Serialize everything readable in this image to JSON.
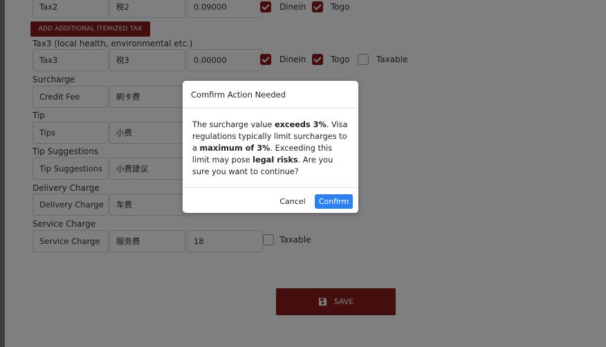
{
  "tax2": {
    "name": "Tax2",
    "name_cn": "税2",
    "rate": "0.09000",
    "dinein_label": "Dinein",
    "togo_label": "Togo"
  },
  "add_tax_button": "ADD ADDITIONAL ITEMIZED TAX",
  "tax3": {
    "section_label": "Tax3 (local health, environmental etc.)",
    "name": "Tax3",
    "name_cn": "税3",
    "rate": "0.00000",
    "dinein_label": "Dinein",
    "togo_label": "Togo",
    "taxable_label": "Taxable"
  },
  "surcharge": {
    "section_label": "Surcharge",
    "name": "Credit Fee",
    "name_cn": "刷卡费"
  },
  "tip": {
    "section_label": "Tip",
    "name": "Tips",
    "name_cn": "小费"
  },
  "tip_suggestions": {
    "section_label": "Tip Suggestions",
    "name": "Tip Suggestions",
    "name_cn": "小费建议"
  },
  "delivery": {
    "section_label": "Delivery Charge",
    "name": "Delivery Charge",
    "name_cn": "车费"
  },
  "service": {
    "section_label": "Service Charge",
    "name": "Service Charge",
    "name_cn": "服务费",
    "value": "18",
    "taxable_label": "Taxable"
  },
  "save_button": "SAVE",
  "modal": {
    "title": "Comfirm Action Needed",
    "body": {
      "t1": "The surcharge value ",
      "b1": "exceeds 3%",
      "t2": ". Visa regulations typically limit surcharges to a ",
      "b2": "maximum of 3%",
      "t3": ". Exceeding this limit may pose ",
      "b3": "legal risks",
      "t4": ". Are you sure you want to continue?"
    },
    "cancel_label": "Cancel",
    "confirm_label": "Confirm"
  },
  "colors": {
    "brand": "#8b1d1d",
    "confirm": "#2f80ed",
    "overlay": "rgba(0,0,0,0.5)"
  }
}
